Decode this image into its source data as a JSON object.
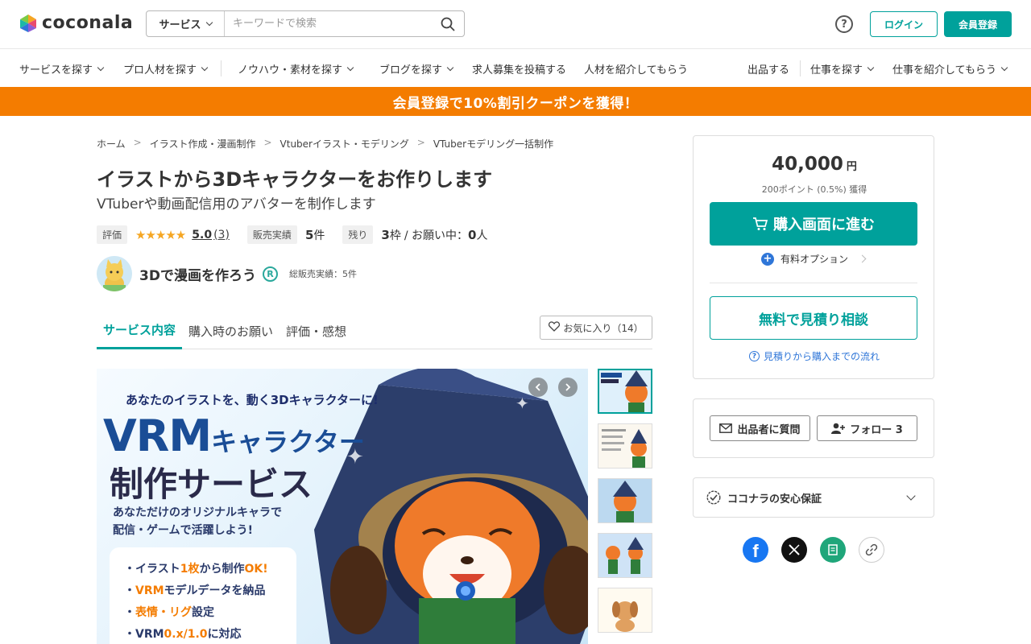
{
  "header": {
    "logo_text": "coconala",
    "search_category": "サービス",
    "search_placeholder": "キーワードで検索",
    "help": "?",
    "login": "ログイン",
    "signup": "会員登録"
  },
  "nav": {
    "left": [
      {
        "label": "サービスを探す",
        "dropdown": true
      },
      {
        "label": "プロ人材を探す",
        "dropdown": true
      },
      {
        "label": "ノウハウ・素材を探す",
        "dropdown": true
      },
      {
        "label": "ブログを探す",
        "dropdown": true
      },
      {
        "label": "求人募集を投稿する",
        "dropdown": false
      },
      {
        "label": "人材を紹介してもらう",
        "dropdown": false
      }
    ],
    "right": [
      {
        "label": "出品する",
        "dropdown": false
      },
      {
        "label": "仕事を探す",
        "dropdown": true
      },
      {
        "label": "仕事を紹介してもらう",
        "dropdown": true
      }
    ]
  },
  "banner": "会員登録で10%割引クーポンを獲得！",
  "breadcrumb": [
    "ホーム",
    "イラスト作成・漫画制作",
    "Vtuberイラスト・モデリング",
    "VTuberモデリング一括制作"
  ],
  "breadcrumb_sep": ">",
  "service": {
    "title": "イラストから3Dキャラクターをお作りします",
    "subtitle": "VTuberや動画配信用のアバターを制作します",
    "rating_label": "評価",
    "stars": "★★★★★",
    "rating": "5.0",
    "rating_count": "(3)",
    "sales_label": "販売実績",
    "sales_value": "5",
    "sales_unit": "件",
    "remaining_label": "残り",
    "remaining_value": "3",
    "remaining_unit": "枠",
    "requests_text": "/ お願い中：",
    "requests_value": "0",
    "requests_unit": "人"
  },
  "seller": {
    "name": "3Dで漫画を作ろう",
    "badge": "R",
    "total_sales": "総販売実績：5件"
  },
  "tabs": [
    {
      "label": "サービス内容",
      "active": true
    },
    {
      "label": "購入時のお願い",
      "active": false
    },
    {
      "label": "評価・感想",
      "active": false
    }
  ],
  "favorite": "お気に入り（14）",
  "hero": {
    "tagline": "あなたのイラストを、動く3Dキャラクターに!",
    "headline_big": "VRM",
    "headline_mid": "キャラクター",
    "headline_line2": "制作サービス",
    "desc_1": "あなただけのオリジナルキャラで",
    "desc_2": "配信・ゲームで活躍しよう!",
    "bullets": [
      {
        "pre": "・イラスト",
        "hl": "1枚",
        "mid": "から制作",
        "hl2": "OK!"
      },
      {
        "pre": "・",
        "hl": "VRM",
        "mid": "モデルデータを納品",
        "hl2": ""
      },
      {
        "pre": "・",
        "hl": "表情・リグ",
        "mid": "設定",
        "hl2": ""
      },
      {
        "pre": "・VRM",
        "hl": "0.x/1.0",
        "mid": "に対応",
        "hl2": ""
      }
    ]
  },
  "pricing": {
    "price": "40,000",
    "currency": "円",
    "points": "200ポイント (0.5%) 獲得",
    "buy": "購入画面に進む",
    "options": "有料オプション",
    "quote": "無料で見積り相談",
    "flow": "見積りから購入までの流れ"
  },
  "seller_actions": {
    "question": "出品者に質問",
    "follow": "フォロー 3"
  },
  "guarantee": "ココナラの安心保証",
  "colors": {
    "accent": "#00a19b",
    "banner": "#f47c00",
    "link": "#2f76d8",
    "star": "#f5a623"
  },
  "share_icons": [
    "facebook-icon",
    "x-icon",
    "note-icon",
    "link-icon"
  ]
}
